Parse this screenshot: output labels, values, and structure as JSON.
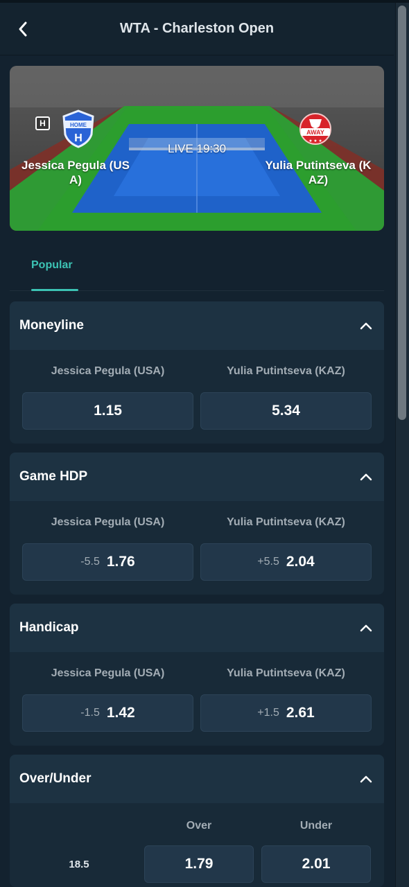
{
  "header": {
    "title": "WTA - Charleston Open"
  },
  "match": {
    "home_name": "Jessica Pegula (USA)",
    "away_name": "Yulia Putintseva (KAZ)",
    "home_marker": "H",
    "live_status": "LIVE 19:30",
    "home_logo_text": "HOME",
    "away_logo_text": "AWAY"
  },
  "tabs": [
    {
      "label": "Popular",
      "active": true
    }
  ],
  "markets": [
    {
      "title": "Moneyline",
      "selections": [
        {
          "name": "Jessica Pegula (USA)",
          "line": "",
          "price": "1.15"
        },
        {
          "name": "Yulia Putintseva (KAZ)",
          "line": "",
          "price": "5.34"
        }
      ]
    },
    {
      "title": "Game HDP",
      "selections": [
        {
          "name": "Jessica Pegula (USA)",
          "line": "-5.5",
          "price": "1.76"
        },
        {
          "name": "Yulia Putintseva (KAZ)",
          "line": "+5.5",
          "price": "2.04"
        }
      ]
    },
    {
      "title": "Handicap",
      "selections": [
        {
          "name": "Jessica Pegula (USA)",
          "line": "-1.5",
          "price": "1.42"
        },
        {
          "name": "Yulia Putintseva (KAZ)",
          "line": "+1.5",
          "price": "2.61"
        }
      ]
    },
    {
      "title": "Over/Under",
      "columns": [
        "Over",
        "Under"
      ],
      "rows": [
        {
          "line": "18.5",
          "over": "1.79",
          "under": "2.01"
        }
      ]
    }
  ],
  "colors": {
    "accent": "#3cc3b4",
    "background": "#13222f",
    "card": "#182a38",
    "odd_button": "#22374a"
  }
}
